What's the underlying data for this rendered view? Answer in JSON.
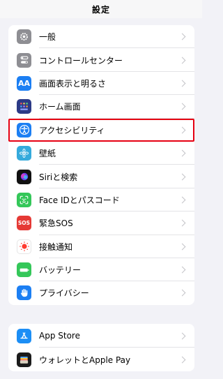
{
  "nav": {
    "title": "設定"
  },
  "group1": [
    {
      "label": "一般",
      "icon": "gear-icon",
      "color": "#8e8e93"
    },
    {
      "label": "コントロールセンター",
      "icon": "control-center-icon",
      "color": "#8e8e93"
    },
    {
      "label": "画面表示と明るさ",
      "icon": "display-brightness-icon",
      "color": "#1c7ff3",
      "glyph": "AA"
    },
    {
      "label": "ホーム画面",
      "icon": "home-screen-icon",
      "color": "#2c3a86"
    },
    {
      "label": "アクセシビリティ",
      "icon": "accessibility-icon",
      "color": "#1c7ff3"
    },
    {
      "label": "壁紙",
      "icon": "wallpaper-icon",
      "color": "#35aadc"
    },
    {
      "label": "Siriと検索",
      "icon": "siri-icon",
      "color": "#111111"
    },
    {
      "label": "Face IDとパスコード",
      "icon": "face-id-icon",
      "color": "#34c759"
    },
    {
      "label": "緊急SOS",
      "icon": "sos-icon",
      "color": "#e53935",
      "glyph": "SOS"
    },
    {
      "label": "接触通知",
      "icon": "exposure-notification-icon",
      "color": "#ffffff"
    },
    {
      "label": "バッテリー",
      "icon": "battery-icon",
      "color": "#34c759"
    },
    {
      "label": "プライバシー",
      "icon": "privacy-hand-icon",
      "color": "#1c7ff3"
    }
  ],
  "group2": [
    {
      "label": "App Store",
      "icon": "app-store-icon",
      "color": "#1c8ef5"
    },
    {
      "label": "ウォレットとApple Pay",
      "icon": "wallet-icon",
      "color": "#1b1b1b"
    }
  ]
}
